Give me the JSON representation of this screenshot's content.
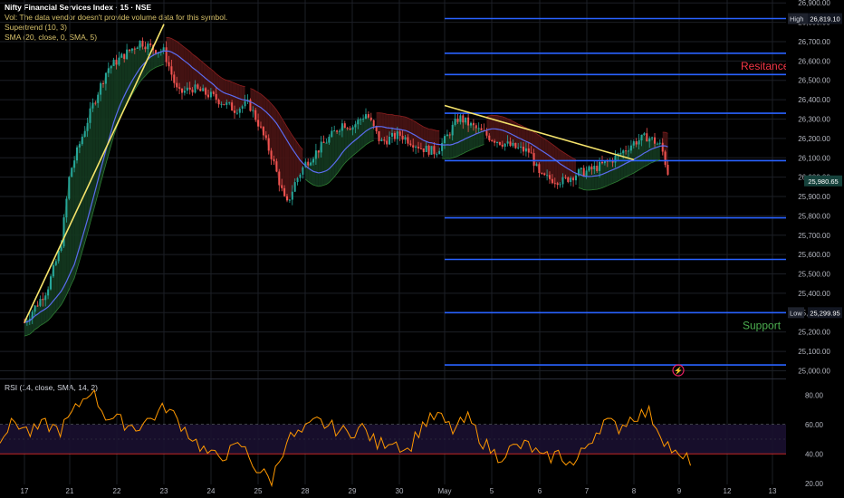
{
  "header": {
    "symbol_line": "Nifty Financial Services Index · 15 · NSE",
    "vol_line": "Vol: The data vendor doesn't provide volume data for this symbol.",
    "supertrend_line": "Supertrend (10, 3)",
    "sma_line": "SMA (20, close, 0, SMA, 5)"
  },
  "rsi_header": "RSI (14, close, SMA, 14, 2)",
  "annotations": {
    "resistance": "Resitance",
    "support": "Support",
    "high_tag": "High",
    "high_value": "26,819.10",
    "low_tag": "Low",
    "low_value": "25,299.95",
    "last_price": "25,980.65"
  },
  "colors": {
    "background": "#000000",
    "up": "#26a69a",
    "down": "#ef5350",
    "sma": "#5b6cf0",
    "trendline": "#f5e36b",
    "hline": "#2962ff",
    "resistance_text": "#f23645",
    "support_text": "#4caf50",
    "rsi": "#ff9800",
    "st_up_fill": "#143a20",
    "st_down_fill": "#4a1414"
  },
  "chart_data": [
    {
      "type": "candlestick",
      "title": "Nifty Financial Services Index · 15 · NSE",
      "x_tick_labels": [
        "17",
        "21",
        "22",
        "23",
        "24",
        "25",
        "28",
        "29",
        "30",
        "May",
        "5",
        "6",
        "7",
        "8",
        "9",
        "12",
        "13"
      ],
      "y_tick_labels": [
        "25,000.00",
        "25,100.00",
        "25,200.00",
        "25,300.00",
        "25,400.00",
        "25,500.00",
        "25,600.00",
        "25,700.00",
        "25,800.00",
        "25,900.00",
        "26,000.00",
        "26,100.00",
        "26,200.00",
        "26,300.00",
        "26,400.00",
        "26,500.00",
        "26,600.00",
        "26,700.00",
        "26,800.00",
        "26,900.00"
      ],
      "ylim": [
        24960,
        26915
      ],
      "price_path": [
        {
          "x": "17",
          "close": 25250
        },
        {
          "x": "17.5",
          "close": 25420
        },
        {
          "x": "17.8",
          "close": 25640
        },
        {
          "x": "21",
          "close": 26020
        },
        {
          "x": "21.5",
          "close": 26380
        },
        {
          "x": "21.8",
          "close": 26560
        },
        {
          "x": "22",
          "close": 26600
        },
        {
          "x": "22.5",
          "close": 26700
        },
        {
          "x": "22.8",
          "close": 26660
        },
        {
          "x": "23",
          "close": 26650
        },
        {
          "x": "23.3",
          "close": 26430
        },
        {
          "x": "23.6",
          "close": 26460
        },
        {
          "x": "24",
          "close": 26420
        },
        {
          "x": "24.5",
          "close": 26350
        },
        {
          "x": "24.8",
          "close": 26380
        },
        {
          "x": "25",
          "close": 26280
        },
        {
          "x": "25.3",
          "close": 26100
        },
        {
          "x": "25.6",
          "close": 25850
        },
        {
          "x": "25.8",
          "close": 25980
        },
        {
          "x": "28",
          "close": 26070
        },
        {
          "x": "28.5",
          "close": 26200
        },
        {
          "x": "28.8",
          "close": 26280
        },
        {
          "x": "29",
          "close": 26260
        },
        {
          "x": "29.3",
          "close": 26330
        },
        {
          "x": "29.6",
          "close": 26180
        },
        {
          "x": "30",
          "close": 26220
        },
        {
          "x": "30.5",
          "close": 26150
        },
        {
          "x": "30.8",
          "close": 26130
        },
        {
          "x": "May",
          "close": 26190
        },
        {
          "x": "May.3",
          "close": 26310
        },
        {
          "x": "May.6",
          "close": 26260
        },
        {
          "x": "5",
          "close": 26200
        },
        {
          "x": "5.5",
          "close": 26150
        },
        {
          "x": "5.8",
          "close": 26130
        },
        {
          "x": "6",
          "close": 26000
        },
        {
          "x": "6.5",
          "close": 25980
        },
        {
          "x": "6.8",
          "close": 26020
        },
        {
          "x": "7",
          "close": 26030
        },
        {
          "x": "7.3",
          "close": 26060
        },
        {
          "x": "7.6",
          "close": 26100
        },
        {
          "x": "8",
          "close": 26180
        },
        {
          "x": "8.3",
          "close": 26210
        },
        {
          "x": "8.6",
          "close": 26160
        },
        {
          "x": "8.8",
          "close": 25980
        }
      ],
      "overlays": [
        "Supertrend (10, 3)",
        "SMA (20, close, 0, SMA, 5)"
      ],
      "horizontal_levels": [
        26819.1,
        26640,
        26530,
        26330,
        26085,
        25790,
        25575,
        25299.95,
        25030
      ],
      "trendlines": [
        {
          "from": {
            "x": "17",
            "y": 25250
          },
          "to": {
            "x": "23",
            "y": 26790
          }
        },
        {
          "from": {
            "x": "May",
            "y": 26370
          },
          "to": {
            "x": "8",
            "y": 26090
          }
        }
      ],
      "last_price": 25980.65,
      "high": 26819.1,
      "low": 25299.95
    },
    {
      "type": "line",
      "title": "RSI (14, close, SMA, 14, 2)",
      "y_tick_labels": [
        "80.00",
        "60.00",
        "40.00",
        "20.00"
      ],
      "ylim": [
        10,
        90
      ],
      "band": [
        40,
        60
      ],
      "series": [
        {
          "name": "RSI",
          "values": [
            52,
            62,
            54,
            60,
            56,
            70,
            84,
            66,
            62,
            58,
            64,
            72,
            60,
            48,
            38,
            40,
            46,
            30,
            22,
            50,
            54,
            62,
            58,
            54,
            58,
            46,
            50,
            42,
            60,
            66,
            56,
            64,
            48,
            38,
            44,
            46,
            36,
            40,
            32,
            48,
            62,
            58,
            66,
            68,
            50,
            36
          ]
        }
      ]
    }
  ]
}
